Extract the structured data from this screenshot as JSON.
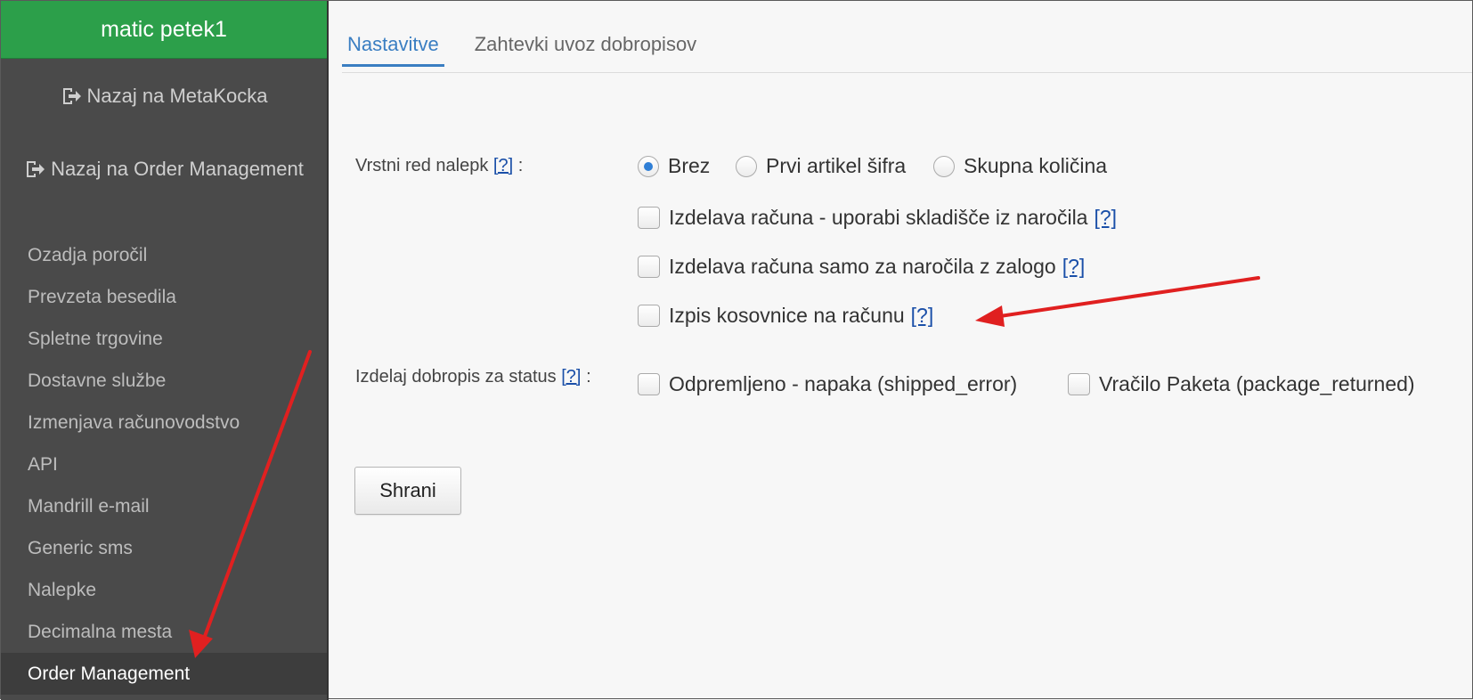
{
  "sidebar": {
    "user": "matic petek1",
    "back_links": [
      {
        "label": "Nazaj na MetaKocka"
      },
      {
        "label": "Nazaj na Order Management"
      }
    ],
    "items": [
      {
        "label": "Ozadja poročil"
      },
      {
        "label": "Prevzeta besedila"
      },
      {
        "label": "Spletne trgovine"
      },
      {
        "label": "Dostavne službe"
      },
      {
        "label": "Izmenjava računovodstvo"
      },
      {
        "label": "API"
      },
      {
        "label": "Mandrill e-mail"
      },
      {
        "label": "Generic sms"
      },
      {
        "label": "Nalepke"
      },
      {
        "label": "Decimalna mesta"
      },
      {
        "label": "Order Management",
        "active": true
      }
    ]
  },
  "tabs": [
    {
      "label": "Nastavitve",
      "active": true
    },
    {
      "label": "Zahtevki uvoz dobropisov"
    }
  ],
  "form": {
    "help_text": "[?]",
    "sort_order": {
      "label": "Vrstni red nalepk",
      "separator": ":",
      "options": [
        {
          "label": "Brez",
          "selected": true
        },
        {
          "label": "Prvi artikel šifra",
          "selected": false
        },
        {
          "label": "Skupna količina",
          "selected": false
        }
      ]
    },
    "checkboxes": [
      {
        "label": "Izdelava računa - uporabi skladišče iz naročila",
        "checked": false
      },
      {
        "label": "Izdelava računa samo za naročila z zalogo",
        "checked": false
      },
      {
        "label": "Izpis kosovnice na računu",
        "checked": false
      }
    ],
    "credit_note": {
      "label": "Izdelaj dobropis za status",
      "separator": ":",
      "options": [
        {
          "label": "Odpremljeno - napaka (shipped_error)",
          "checked": false
        },
        {
          "label": "Vračilo Paketa (package_returned)",
          "checked": false
        }
      ]
    },
    "save_label": "Shrani"
  },
  "colors": {
    "sidebar_header": "#2c9f4a",
    "sidebar_bg": "#4a4a4a",
    "tab_active": "#3a7ec2",
    "annotation_arrow": "#e02020"
  }
}
